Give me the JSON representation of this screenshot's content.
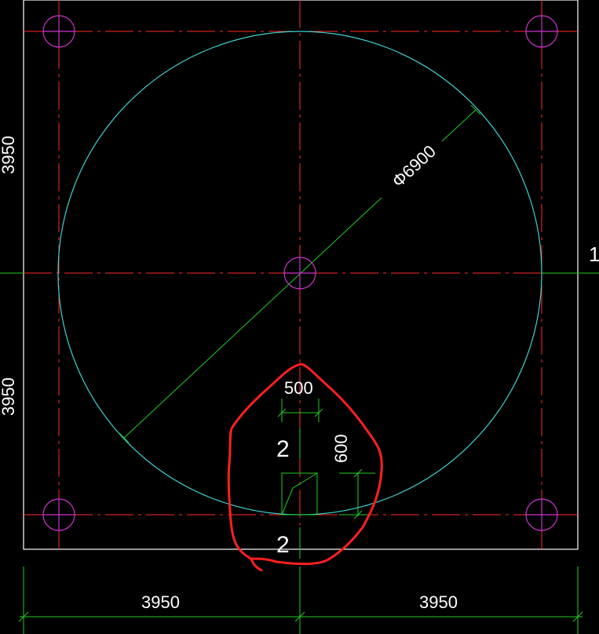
{
  "drawing": {
    "diameter_label": "Φ6900",
    "axis_number": "1",
    "opening_width": "500",
    "opening_height": "600",
    "section_mark_top": "2",
    "section_mark_bottom": "2",
    "dim_left_upper": "3950",
    "dim_left_lower": "3950",
    "dim_bottom_left": "3950",
    "dim_bottom_right": "3950"
  },
  "colors": {
    "background": "#000000",
    "outline": "#ffffff",
    "axis": "#ff2a2a",
    "circle": "#3fd0d0",
    "dimension": "#22cc22",
    "pile": "#cc33cc",
    "highlight": "#ff2020",
    "text": "#ffffff"
  }
}
